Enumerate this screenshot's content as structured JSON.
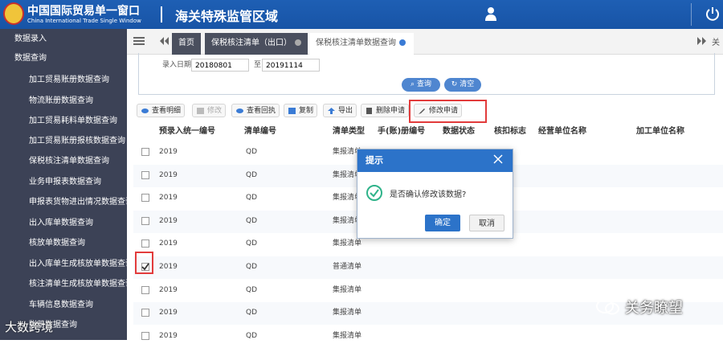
{
  "header": {
    "logo_title": "中国国际贸易单一窗口",
    "logo_subtitle": "China International Trade Single Window",
    "title": "海关特殊监管区域"
  },
  "sidebar": {
    "items": [
      {
        "label": "数据录入",
        "level": "top"
      },
      {
        "label": "数据查询",
        "level": "top"
      },
      {
        "label": "加工贸易账册数据查询",
        "level": "sub"
      },
      {
        "label": "物流账册数据查询",
        "level": "sub"
      },
      {
        "label": "加工贸易耗料单数据查询",
        "level": "sub"
      },
      {
        "label": "加工贸易账册报核数据查询",
        "level": "sub"
      },
      {
        "label": "保税核注清单数据查询",
        "level": "sub"
      },
      {
        "label": "业务申报表数据查询",
        "level": "sub"
      },
      {
        "label": "申报表货物进出情况数据查询",
        "level": "sub"
      },
      {
        "label": "出入库单数据查询",
        "level": "sub"
      },
      {
        "label": "核放单数据查询",
        "level": "sub"
      },
      {
        "label": "出入库单生成核放单数据查询",
        "level": "sub"
      },
      {
        "label": "核注清单生成核放单数据查询",
        "level": "sub"
      },
      {
        "label": "车辆信息数据查询",
        "level": "sub"
      },
      {
        "label": "账册数据查询",
        "level": "sub"
      }
    ]
  },
  "tabs": {
    "home": "首页",
    "tab1": "保税核注清单（出口）",
    "tab2": "保税核注清单数据查询",
    "close_tab": "关"
  },
  "filter": {
    "date_label": "录入日期",
    "date_from": "20180801",
    "date_to_label": "至",
    "date_to": "20191114",
    "query_btn": "查询",
    "clear_btn": "清空"
  },
  "toolbar": {
    "view_detail": "查看明细",
    "edit": "修改",
    "view_receipt": "查看回执",
    "copy": "复制",
    "export": "导出",
    "delete_request": "删除申请",
    "edit_request": "修改申请"
  },
  "table": {
    "headers": [
      "预录入统一编号",
      "清单编号",
      "清单类型",
      "手(账)册编号",
      "数据状态",
      "核扣标志",
      "经营单位名称",
      "加工单位名称"
    ],
    "rows": [
      {
        "id": "2019",
        "no": "QD",
        "type": "集报清单",
        "checked": false
      },
      {
        "id": "2019",
        "no": "QD",
        "type": "集报清单",
        "checked": false
      },
      {
        "id": "2019",
        "no": "QD",
        "type": "集报清单",
        "checked": false
      },
      {
        "id": "2019",
        "no": "QD",
        "type": "集报清单",
        "checked": false
      },
      {
        "id": "2019",
        "no": "QD",
        "type": "集报清单",
        "checked": false
      },
      {
        "id": "2019",
        "no": "QD",
        "type": "普通清单",
        "checked": true
      },
      {
        "id": "2019",
        "no": "QD",
        "type": "集报清单",
        "checked": false
      },
      {
        "id": "2019",
        "no": "QD",
        "type": "集报清单",
        "checked": false
      },
      {
        "id": "2019",
        "no": "QD",
        "type": "集报清单",
        "checked": false
      }
    ]
  },
  "modal": {
    "title": "提示",
    "message": "是否确认修改该数据?",
    "ok": "确定",
    "cancel": "取消"
  },
  "watermark": {
    "right": "关务瞭望",
    "left": "大数跨境"
  },
  "colors": {
    "header_blue": "#1e5fb4",
    "sidebar_bg": "#3c4256",
    "highlight_red": "#e23b3b",
    "modal_blue": "#2c73c9"
  }
}
